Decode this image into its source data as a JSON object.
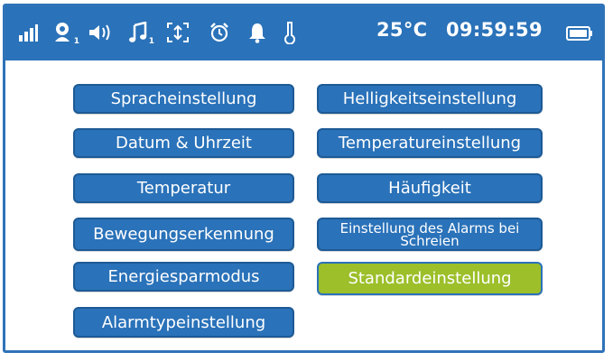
{
  "status_bar": {
    "icons": [
      {
        "name": "signal-icon"
      },
      {
        "name": "baby-monitor-icon",
        "subscript": "1"
      },
      {
        "name": "volume-icon"
      },
      {
        "name": "music-icon",
        "subscript": "1"
      },
      {
        "name": "zoom-icon"
      },
      {
        "name": "alarm-clock-icon"
      },
      {
        "name": "bell-icon"
      },
      {
        "name": "thermometer-icon"
      }
    ],
    "temperature": "25°C",
    "time": "09:59:59",
    "battery": "battery-icon"
  },
  "menu": {
    "left": [
      {
        "label": "Spracheinstellung"
      },
      {
        "label": "Datum & Uhrzeit"
      },
      {
        "label": "Temperatur"
      },
      {
        "label": "Bewegungserkennung"
      },
      {
        "label": "Energiesparmodus"
      },
      {
        "label": "Alarmtypeinstellung"
      }
    ],
    "right": [
      {
        "label": "Helligkeitseinstellung"
      },
      {
        "label": "Temperatureinstellung"
      },
      {
        "label": "Häufigkeit"
      },
      {
        "label": "Einstellung des Alarms bei Schreien"
      },
      {
        "label": "Standardeinstellung",
        "selected": true
      }
    ]
  },
  "colors": {
    "primary": "#2a72b9",
    "selected": "#9cbf2a",
    "text": "#ffffff"
  }
}
